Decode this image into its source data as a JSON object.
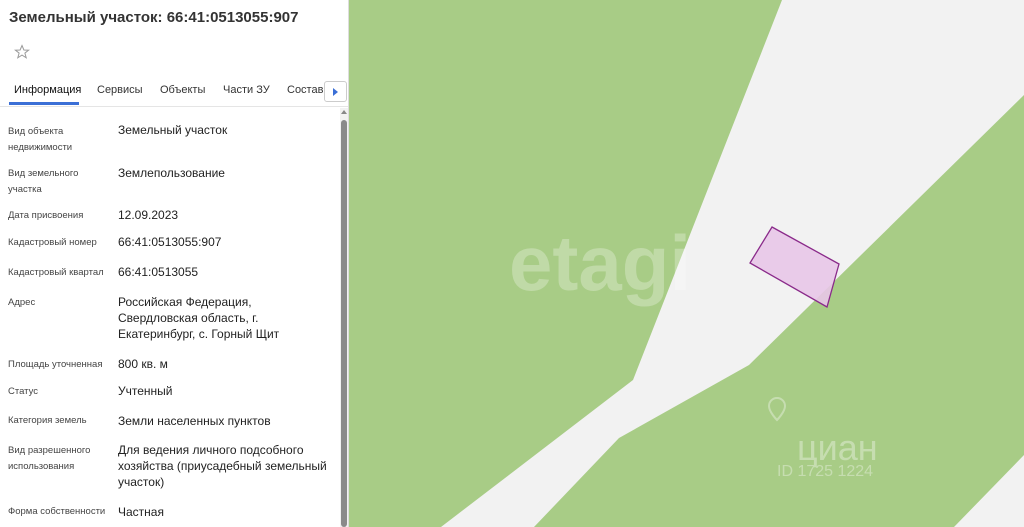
{
  "panel": {
    "title": "Земельный участок: 66:41:0513055:907",
    "star_icon": "star-outline-icon",
    "tabs": [
      {
        "label": "Информация",
        "active": true
      },
      {
        "label": "Сервисы",
        "active": false
      },
      {
        "label": "Объекты",
        "active": false
      },
      {
        "label": "Части ЗУ",
        "active": false
      },
      {
        "label": "Состав",
        "active": false
      }
    ],
    "tab_next_icon": "chevron-right-icon",
    "rows": [
      {
        "label": "Вид объекта недвижимости",
        "value": "Земельный участок"
      },
      {
        "label": "Вид земельного участка",
        "value": "Землепользование"
      },
      {
        "label": "Дата присвоения",
        "value": "12.09.2023"
      },
      {
        "label": "Кадастровый номер",
        "value": "66:41:0513055:907"
      },
      {
        "label": "Кадастровый квартал",
        "value": "66:41:0513055"
      },
      {
        "label": "Адрес",
        "value": "Российская Федерация, Свердловская область, г. Екатеринбург, с. Горный Щит"
      },
      {
        "label": "Площадь уточненная",
        "value": "800 кв. м"
      },
      {
        "label": "Статус",
        "value": "Учтенный"
      },
      {
        "label": "Категория земель",
        "value": "Земли населенных пунктов"
      },
      {
        "label": "Вид разрешенного использования",
        "value": "Для ведения личного подсобного хозяйства (приусадебный земельный участок)"
      },
      {
        "label": "Форма собственности",
        "value": "Частная"
      }
    ]
  },
  "map": {
    "watermark_etagi": "etagi",
    "watermark_cian": "циан",
    "watermark_cian_id": "ID 1725 1224",
    "colors": {
      "green": "#a8cc86",
      "road": "#f2f2f2",
      "parcel_fill": "#e8c6e8",
      "parcel_stroke": "#8a2a8a"
    }
  }
}
